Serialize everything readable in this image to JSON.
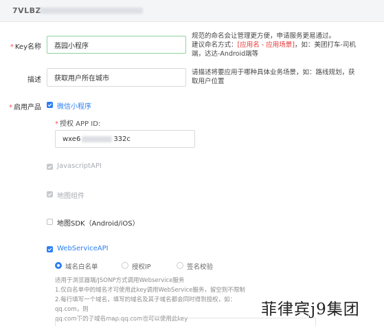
{
  "header": {
    "key_prefix": "7VLBZ"
  },
  "form": {
    "key_name": {
      "required": "*",
      "label": "Key名称",
      "value": "荔园小程序",
      "hint_line1": "规范的命名会让管理更方便，申请服务更易通过。",
      "hint_line2_a": "建议命名方式：",
      "hint_line2_b": "[应用名 - 应用场景]",
      "hint_line2_c": "，如：美团打车-司机",
      "hint_line3": "端，达达-Android端等"
    },
    "description": {
      "label": "描述",
      "value": "获取用户所在城市",
      "hint_line1": "请描述将要应用于哪种具体业务场景，如：路线规划，获",
      "hint_line2": "取用户位置"
    },
    "products": {
      "required": "*",
      "label": "启用产品"
    },
    "wechat_mini": {
      "label": "微信小程序",
      "checked": true
    },
    "app_id": {
      "required": "*",
      "label": "授权 APP ID:",
      "value_prefix": "wxe6",
      "value_suffix": "332c"
    },
    "javascript_api": {
      "label": "JavascriptAPI",
      "checked": true,
      "disabled": true
    },
    "map_component": {
      "label": "地图组件",
      "checked": true,
      "disabled": true
    },
    "map_sdk": {
      "label": "地图SDK（Android/iOS）",
      "checked": false
    },
    "webservice_api": {
      "label": "WebServiceAPI",
      "checked": true
    },
    "auth_modes": {
      "options": [
        {
          "label": "域名白名单",
          "selected": true
        },
        {
          "label": "授权IP",
          "selected": false
        },
        {
          "label": "签名校验",
          "selected": false
        }
      ]
    },
    "notes": [
      "适用于浏览器端/JSONP方式调用Webservice服务",
      "1.仅白名单中的域名才可使用此key调用WebService服务，留空则不限制",
      "2.每行填写一个域名，填写的域名及其子域名都会同时得到授权，如：qq.com，则",
      "qq.com下的子域名map.qq.com也可以使用此key"
    ]
  },
  "watermark": "菲律宾j9集团",
  "colors": {
    "accent": "#2b7ef5",
    "required": "#ff4d4f",
    "highlight": "#e8322f",
    "active_border": "#8fd19e"
  }
}
